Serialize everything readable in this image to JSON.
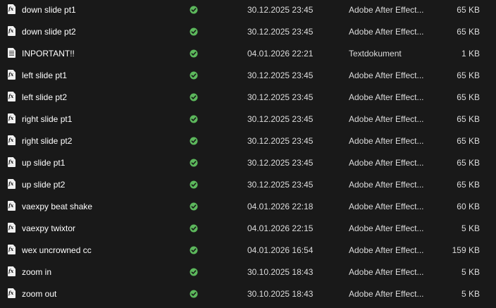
{
  "files": [
    {
      "name": "down slide pt1",
      "modified": "30.12.2025 23:45",
      "type": "Adobe After Effect...",
      "size": "65 KB",
      "icon": "after-effects-preset-icon",
      "sync_status": "synced"
    },
    {
      "name": "down slide pt2",
      "modified": "30.12.2025 23:45",
      "type": "Adobe After Effect...",
      "size": "65 KB",
      "icon": "after-effects-preset-icon",
      "sync_status": "synced"
    },
    {
      "name": "INPORTANT!!",
      "modified": "04.01.2026 22:21",
      "type": "Textdokument",
      "size": "1 KB",
      "icon": "text-document-icon",
      "sync_status": "synced"
    },
    {
      "name": "left slide pt1",
      "modified": "30.12.2025 23:45",
      "type": "Adobe After Effect...",
      "size": "65 KB",
      "icon": "after-effects-preset-icon",
      "sync_status": "synced"
    },
    {
      "name": "left slide pt2",
      "modified": "30.12.2025 23:45",
      "type": "Adobe After Effect...",
      "size": "65 KB",
      "icon": "after-effects-preset-icon",
      "sync_status": "synced"
    },
    {
      "name": "right slide pt1",
      "modified": "30.12.2025 23:45",
      "type": "Adobe After Effect...",
      "size": "65 KB",
      "icon": "after-effects-preset-icon",
      "sync_status": "synced"
    },
    {
      "name": "right slide pt2",
      "modified": "30.12.2025 23:45",
      "type": "Adobe After Effect...",
      "size": "65 KB",
      "icon": "after-effects-preset-icon",
      "sync_status": "synced"
    },
    {
      "name": "up slide pt1",
      "modified": "30.12.2025 23:45",
      "type": "Adobe After Effect...",
      "size": "65 KB",
      "icon": "after-effects-preset-icon",
      "sync_status": "synced"
    },
    {
      "name": "up slide pt2",
      "modified": "30.12.2025 23:45",
      "type": "Adobe After Effect...",
      "size": "65 KB",
      "icon": "after-effects-preset-icon",
      "sync_status": "synced"
    },
    {
      "name": "vaexpy beat shake",
      "modified": "04.01.2026 22:18",
      "type": "Adobe After Effect...",
      "size": "60 KB",
      "icon": "after-effects-preset-icon",
      "sync_status": "synced"
    },
    {
      "name": "vaexpy twixtor",
      "modified": "04.01.2026 22:15",
      "type": "Adobe After Effect...",
      "size": "5 KB",
      "icon": "after-effects-preset-icon",
      "sync_status": "synced"
    },
    {
      "name": "wex uncrowned cc",
      "modified": "04.01.2026 16:54",
      "type": "Adobe After Effect...",
      "size": "159 KB",
      "icon": "after-effects-preset-icon",
      "sync_status": "synced"
    },
    {
      "name": "zoom in",
      "modified": "30.10.2025 18:43",
      "type": "Adobe After Effect...",
      "size": "5 KB",
      "icon": "after-effects-preset-icon",
      "sync_status": "synced"
    },
    {
      "name": "zoom out",
      "modified": "30.10.2025 18:43",
      "type": "Adobe After Effect...",
      "size": "5 KB",
      "icon": "after-effects-preset-icon",
      "sync_status": "synced"
    }
  ],
  "colors": {
    "background": "#191919",
    "synced_green": "#5cb85c",
    "text_primary": "#ffffff",
    "text_secondary": "#dcdcdc"
  }
}
